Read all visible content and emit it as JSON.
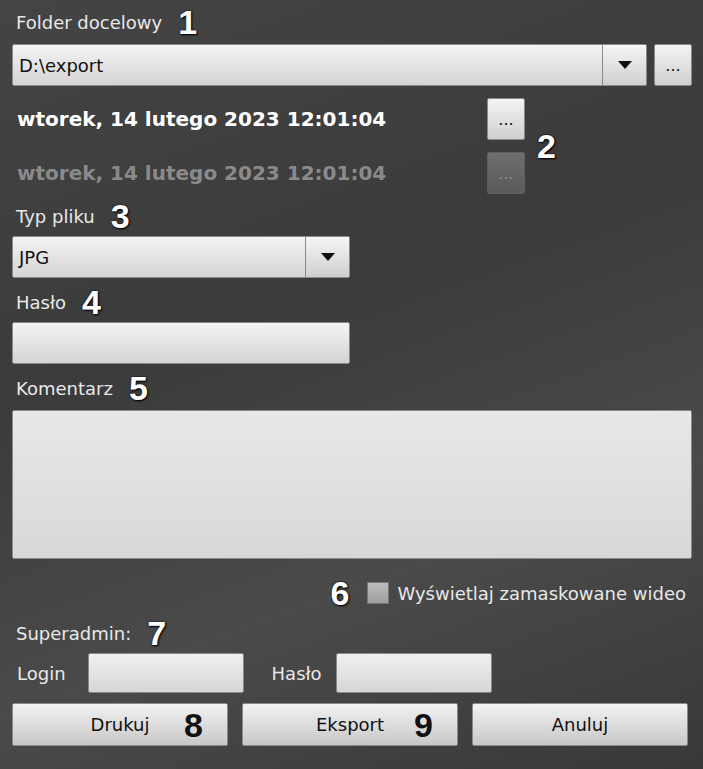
{
  "folder": {
    "label": "Folder docelowy",
    "badge": "1",
    "value": "D:\\export",
    "browse": "..."
  },
  "dates": {
    "badge": "2",
    "rows": [
      {
        "value": "wtorek, 14 lutego 2023 12:01:04",
        "button": "...",
        "disabled": false
      },
      {
        "value": "wtorek, 14 lutego 2023 12:01:04",
        "button": "...",
        "disabled": true
      }
    ]
  },
  "file_type": {
    "label": "Typ pliku",
    "badge": "3",
    "value": "JPG"
  },
  "password": {
    "label": "Hasło",
    "badge": "4",
    "value": ""
  },
  "comment": {
    "label": "Komentarz",
    "badge": "5",
    "value": ""
  },
  "masked": {
    "label": "Wyświetlaj zamaskowane wideo",
    "badge": "6",
    "checked": false
  },
  "superadmin": {
    "label": "Superadmin:",
    "badge": "7",
    "login_label": "Login",
    "login_value": "",
    "password_label": "Hasło",
    "password_value": ""
  },
  "buttons": [
    {
      "label": "Drukuj",
      "badge": "8"
    },
    {
      "label": "Eksport",
      "badge": "9"
    },
    {
      "label": "Anuluj"
    }
  ]
}
